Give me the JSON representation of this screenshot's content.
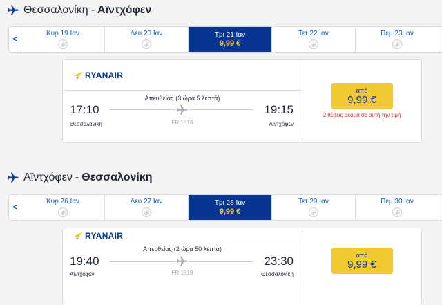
{
  "outbound": {
    "from": "Θεσσαλονίκη",
    "separator": "-",
    "to": "Αϊντχόφεν",
    "nav_arrow": "<",
    "dates": [
      {
        "label": "Κυρ 19 Ιαν",
        "selected": false
      },
      {
        "label": "Δευ 20 Ιαν",
        "selected": false
      },
      {
        "label": "Τρι 21 Ιαν",
        "selected": true,
        "price": "9,99 €"
      },
      {
        "label": "Τετ 22 Ιαν",
        "selected": false
      },
      {
        "label": "Πεμ 23 Ιαν",
        "selected": false
      }
    ],
    "flight": {
      "airline": "RYANAIR",
      "type": "Απευθείας",
      "duration": "(3 ώρα 5 λεπτά)",
      "dep_time": "17:10",
      "arr_time": "19:15",
      "dep_city": "Θεσσαλονίκη",
      "arr_city": "Αϊντχόφεν",
      "flight_no": "FR 1818",
      "price_prefix": "από",
      "price": "9,99 €",
      "seats_note": "2 θέσεις ακόμα σε αυτή την τιμή"
    }
  },
  "return": {
    "from": "Αϊντχόφεν",
    "separator": "-",
    "to": "Θεσσαλονίκη",
    "nav_arrow": "<",
    "dates": [
      {
        "label": "Κυρ 26 Ιαν",
        "selected": false
      },
      {
        "label": "Δευ 27 Ιαν",
        "selected": false
      },
      {
        "label": "Τρι 28 Ιαν",
        "selected": true,
        "price": "9,99 €"
      },
      {
        "label": "Τετ 29 Ιαν",
        "selected": false
      },
      {
        "label": "Πεμ 30 Ιαν",
        "selected": false
      }
    ],
    "flight": {
      "airline": "RYANAIR",
      "type": "Απευθείας",
      "duration": "(2 ώρα 50 λεπτά)",
      "dep_time": "19:40",
      "arr_time": "23:30",
      "dep_city": "Αϊντχόφεν",
      "arr_city": "Θεσσαλονίκη",
      "flight_no": "FR 1819",
      "price_prefix": "από",
      "price": "9,99 €"
    }
  },
  "colors": {
    "brand_blue": "#073590",
    "link_blue": "#0d5dbf",
    "price_yellow": "#f1c933",
    "warning_red": "#c9302c"
  }
}
